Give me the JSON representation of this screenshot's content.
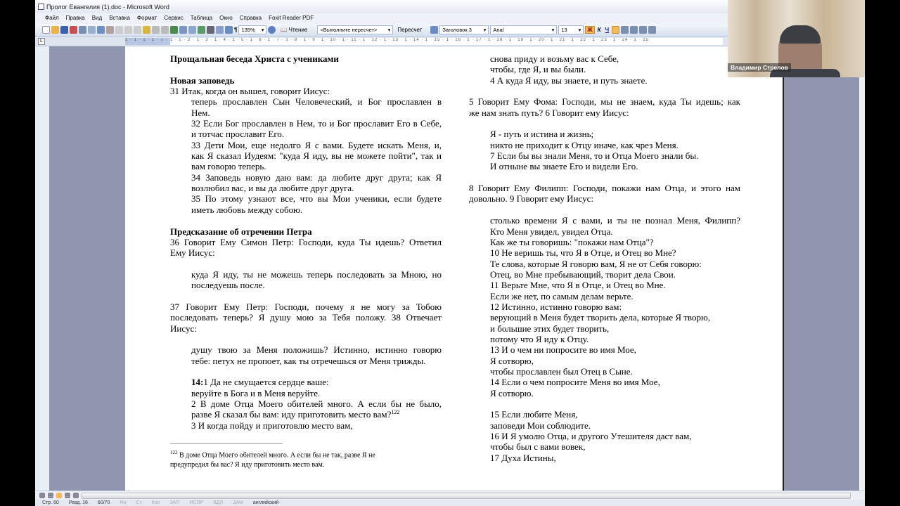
{
  "window": {
    "title": "Пролог Евангелия (1).doc - Microsoft Word"
  },
  "menu": [
    "Файл",
    "Правка",
    "Вид",
    "Вставка",
    "Формат",
    "Сервис",
    "Таблица",
    "Окно",
    "Справка",
    "Foxit Reader PDF"
  ],
  "toolbar": {
    "zoom": "135%",
    "reading": "Чтение",
    "recalc_field": "<Выполните пересчет>",
    "recalc_button": "Пересчет",
    "style": "Заголовок 3",
    "font": "Arial",
    "size": "13",
    "bold": "Ж",
    "italic": "К",
    "underline": "Ч"
  },
  "ruler": {
    "ticks": "2 · 1 · 1 · 1 · ⌂ · 1 · 1 · 2 · 1 · 3 · 1 · 4 · 1 · 5 · 1 · 6 · 1 · 7 · 1 · 8 · 1 · 9 · 1 · 10 · 1 · 11 · 1 · 12 · 1 · 13 · 1 · 14 · 1 · 15 · 1 · 16 · 1 · 17 · 1 · 18 · 1 · 19 · 1 · 20 · 1 · 21 · 1 · 22 · 1 · 23 · 1 · 24 · 1 · 25"
  },
  "document": {
    "left_column": [
      {
        "text": "Прощальная беседа Христа с учениками",
        "kind": "heading"
      },
      {
        "text": "",
        "kind": "blank"
      },
      {
        "text": "Новая заповедь",
        "kind": "heading"
      },
      {
        "text": "31 Итак, когда он вышел, говорит Иисус:",
        "kind": "text-end"
      },
      {
        "text": "теперь прославлен Сын Человеческий, и Бог прославлен в",
        "kind": "quote"
      },
      {
        "text": "Нем.",
        "kind": "quote-end"
      },
      {
        "text": "32 Если Бог прославлен в Нем, то и Бог прославит Его в Себе,",
        "kind": "quote"
      },
      {
        "text": "и тотчас прославит Его.",
        "kind": "quote-end"
      },
      {
        "text": "33 Дети Мои, еще недолго Я с вами. Будете искать Меня, и,",
        "kind": "quote"
      },
      {
        "text": "как Я сказал Иудеям: \"куда Я иду, вы не можете пойти\", так и",
        "kind": "quote"
      },
      {
        "text": "вам говорю теперь.",
        "kind": "quote-end"
      },
      {
        "text": "34 Заповедь новую даю вам: да любите друг друга; как Я",
        "kind": "quote"
      },
      {
        "text": "возлюбил вас, и вы да любите друг друга.",
        "kind": "quote-end"
      },
      {
        "text": "35 По этому узнают все, что вы Мои ученики, если будете",
        "kind": "quote"
      },
      {
        "text": "иметь любовь между собою.",
        "kind": "quote-end"
      },
      {
        "text": "",
        "kind": "blank"
      },
      {
        "text": "Предсказание об отречении Петра",
        "kind": "heading"
      },
      {
        "text": "36 Говорит Ему Симон Петр: Господи, куда Ты идешь? Ответил",
        "kind": "text"
      },
      {
        "text": "Ему Иисус:",
        "kind": "text-end"
      },
      {
        "text": "",
        "kind": "blank"
      },
      {
        "text": "куда Я иду, ты не можешь теперь последовать за Мною, но",
        "kind": "quote"
      },
      {
        "text": "последуешь после.",
        "kind": "quote-end"
      },
      {
        "text": "",
        "kind": "blank"
      },
      {
        "text": "37 Говорит Ему Петр: Господи, почему я не могу за Тобою",
        "kind": "text"
      },
      {
        "text": "последовать теперь? Я душу мою за Тебя положу. 38 Отвечает",
        "kind": "text"
      },
      {
        "text": "Иисус:",
        "kind": "text-end"
      },
      {
        "text": "",
        "kind": "blank"
      },
      {
        "text": "душу твою за Меня положишь? Истинно, истинно говорю",
        "kind": "quote"
      },
      {
        "text": "тебе: петух не пропоет, как ты отречешься от Меня трижды.",
        "kind": "quote-end"
      },
      {
        "text": "",
        "kind": "blank"
      },
      {
        "bold": "14:",
        "text": "1 Да не смущается сердце ваше:",
        "kind": "quote-end"
      },
      {
        "text": "веруйте в Бога и в Меня веруйте.",
        "kind": "quote-end"
      },
      {
        "text": "2 В доме Отца Моего обителей много. А если бы не было,",
        "kind": "quote"
      },
      {
        "text": "разве Я сказал бы вам: иду приготовить место вам?",
        "sup": "122",
        "kind": "quote-end"
      },
      {
        "text": "3 И когда пойду и приготовлю место вам,",
        "kind": "quote-end"
      }
    ],
    "right_column": [
      {
        "text": "снова приду и возьму вас к Себе,",
        "kind": "quote-end"
      },
      {
        "text": "чтобы, где Я, и вы были.",
        "kind": "quote-end"
      },
      {
        "text": "4 А куда Я иду, вы знаете, и путь знаете.",
        "kind": "quote-end"
      },
      {
        "text": "",
        "kind": "blank"
      },
      {
        "text": "5 Говорит Ему Фома: Господи, мы не знаем, куда Ты идешь; как",
        "kind": "text"
      },
      {
        "text": "же нам знать путь? 6 Говорит ему Иисус:",
        "kind": "text-end"
      },
      {
        "text": "",
        "kind": "blank"
      },
      {
        "text": "Я - путь и истина и жизнь;",
        "kind": "quote-end"
      },
      {
        "text": "никто не приходит к Отцу иначе, как чрез Меня.",
        "kind": "quote-end"
      },
      {
        "text": "7 Если бы вы знали Меня, то и Отца Моего знали бы.",
        "kind": "quote-end"
      },
      {
        "text": "И отныне вы знаете Его и видели Его.",
        "kind": "quote-end"
      },
      {
        "text": "",
        "kind": "blank"
      },
      {
        "text": "8 Говорит Ему Филипп: Господи, покажи нам Отца, и этого нам",
        "kind": "text"
      },
      {
        "text": "довольно. 9 Говорит ему Иисус:",
        "kind": "text-end"
      },
      {
        "text": "",
        "kind": "blank"
      },
      {
        "text": "столько времени Я с вами, и ты не познал Меня, Филипп?",
        "kind": "quote"
      },
      {
        "text": "Кто Меня увидел, увидел Отца.",
        "kind": "quote-end"
      },
      {
        "text": "Как же ты говоришь: \"покажи нам Отца\"?",
        "kind": "quote-end"
      },
      {
        "text": "10 Не веришь ты, что Я в Отце, и Отец во Мне?",
        "kind": "quote-end"
      },
      {
        "text": "Те слова, которые Я говорю вам, Я не от Себя говорю:",
        "kind": "quote-end"
      },
      {
        "text": "Отец, во Мне пребывающий, творит дела Свои.",
        "kind": "quote-end"
      },
      {
        "text": "11 Верьте Мне, что Я в Отце, и Отец во Мне.",
        "kind": "quote-end"
      },
      {
        "text": "Если же нет, по самым делам верьте.",
        "kind": "quote-end"
      },
      {
        "text": "12 Истинно, истинно говорю вам:",
        "kind": "quote-end"
      },
      {
        "text": "верующий в Меня будет творить дела, которые Я творю,",
        "kind": "quote-end"
      },
      {
        "text": "и большие этих будет творить,",
        "kind": "quote-end"
      },
      {
        "text": "потому что Я иду к Отцу.",
        "kind": "quote-end"
      },
      {
        "text": "13 И о чем ни попросите во имя Мое,",
        "kind": "quote-end"
      },
      {
        "text": "Я сотворю,",
        "kind": "quote-end"
      },
      {
        "text": "чтобы прославлен был Отец в Сыне.",
        "kind": "quote-end"
      },
      {
        "text": "14 Если о чем попросите Меня во имя Мое,",
        "kind": "quote-end"
      },
      {
        "text": "Я сотворю.",
        "kind": "quote-end"
      },
      {
        "text": "",
        "kind": "blank"
      },
      {
        "text": "15 Если любите Меня,",
        "kind": "quote-end"
      },
      {
        "text": "заповеди Мои соблюдите.",
        "kind": "quote-end"
      },
      {
        "text": "16 И Я умолю Отца, и другого Утешителя даст вам,",
        "kind": "quote-end"
      },
      {
        "text": "чтобы был с вами вовек,",
        "kind": "quote-end"
      },
      {
        "text": "17 Духа Истины,",
        "kind": "quote-end"
      }
    ],
    "footnote": {
      "number": "122",
      "line1": "В доме Отца Моего обителей много. А если бы не так, разве Я не",
      "line2": "предупредил бы вас? Я иду приготовить место вам."
    }
  },
  "status": {
    "page": "Стр. 60",
    "section": "Разд. 16",
    "pages": "60/70",
    "at": "На",
    "line": "Ст",
    "col": "Кол",
    "rec": "ЗАП",
    "trk": "ИСПР",
    "ext": "ВДЛ",
    "ovr": "ЗАМ",
    "language": "английский"
  },
  "webcam": {
    "participant": "Владимир Стрелов"
  },
  "colors": {
    "page_background": "#8f96ae",
    "toolbar": "#dfe6f2",
    "active_button": "#f5b95a"
  }
}
